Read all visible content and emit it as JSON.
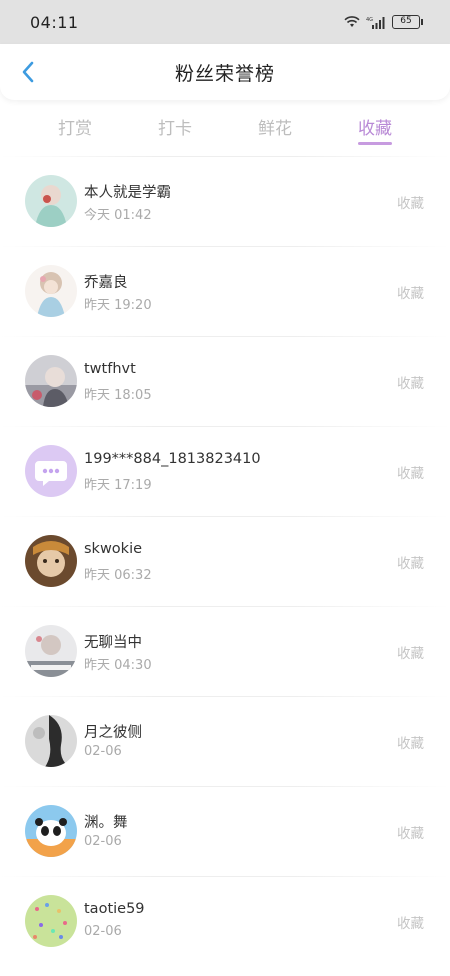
{
  "status_bar": {
    "time": "04:11",
    "signal_label": "4G",
    "battery": "65"
  },
  "header": {
    "title": "粉丝荣誉榜",
    "back_icon": "chevron-left-icon"
  },
  "tabs": [
    {
      "label": "打赏",
      "active": false
    },
    {
      "label": "打卡",
      "active": false
    },
    {
      "label": "鲜花",
      "active": false
    },
    {
      "label": "收藏",
      "active": true
    }
  ],
  "colors": {
    "accent": "#b98ad6",
    "muted": "#bdbdbd",
    "back_arrow": "#3d9be0"
  },
  "fans": [
    {
      "name": "本人就是学霸",
      "time": "今天 01:42",
      "action": "收藏"
    },
    {
      "name": "乔嘉良",
      "time": "昨天 19:20",
      "action": "收藏"
    },
    {
      "name": "twtfhvt",
      "time": "昨天 18:05",
      "action": "收藏"
    },
    {
      "name": "199***884_1813823410",
      "time": "昨天 17:19",
      "action": "收藏"
    },
    {
      "name": "skwokie",
      "time": "昨天 06:32",
      "action": "收藏"
    },
    {
      "name": "无聊当中",
      "time": "昨天 04:30",
      "action": "收藏"
    },
    {
      "name": "月之彼侧",
      "time": "02-06",
      "action": "收藏"
    },
    {
      "name": "渊。舞",
      "time": "02-06",
      "action": "收藏"
    },
    {
      "name": "taotie59",
      "time": "02-06",
      "action": "收藏"
    }
  ]
}
